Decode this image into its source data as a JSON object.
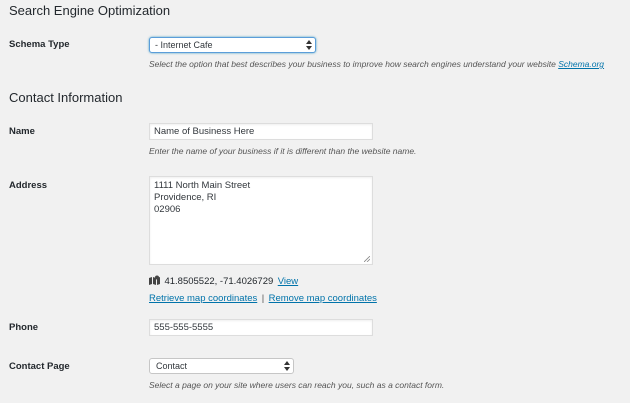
{
  "seo": {
    "heading": "Search Engine Optimization",
    "schema_label": "Schema Type",
    "schema_value": "- Internet Cafe",
    "schema_desc": "Select the option that best describes your business to improve how search engines understand your website",
    "schema_link": "Schema.org"
  },
  "contact": {
    "heading": "Contact Information",
    "name_label": "Name",
    "name_value": "Name of Business Here",
    "name_desc": "Enter the name of your business if it is different than the website name.",
    "address_label": "Address",
    "address_lines": [
      "1111 North Main Street",
      "Providence, RI",
      "02906"
    ],
    "coords": "41.8505522, -71.4026729",
    "view_link": "View",
    "retrieve_link": "Retrieve map coordinates",
    "separator": "|",
    "remove_link": "Remove map coordinates",
    "phone_label": "Phone",
    "phone_value": "555-555-5555",
    "page_label": "Contact Page",
    "page_value": "Contact",
    "page_desc": "Select a page on your site where users can reach you, such as a contact form."
  },
  "icons": {
    "map": "map-icon",
    "select_arrows": "updown-arrows-icon",
    "resize": "resize-grip-icon"
  }
}
